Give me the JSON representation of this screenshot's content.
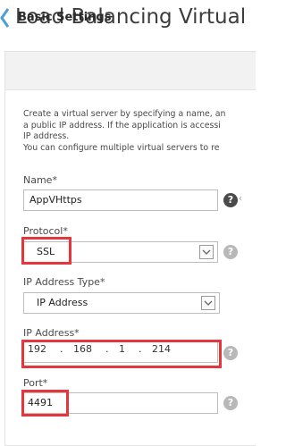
{
  "page": {
    "title": "Load Balancing Virtual"
  },
  "panel": {
    "title": "Basic Settings"
  },
  "description": {
    "lines": [
      "Create a virtual server by specifying a name, an",
      "a public IP address. If the application is accessi",
      "IP address.",
      "You can configure multiple virtual servers to re"
    ]
  },
  "fields": {
    "name": {
      "label": "Name*",
      "value": "AppVHttps"
    },
    "protocol": {
      "label": "Protocol*",
      "value": "SSL"
    },
    "ip_type": {
      "label": "IP Address Type*",
      "value": "IP Address"
    },
    "ip_address": {
      "label": "IP Address*",
      "octets": [
        "192",
        "168",
        "1",
        "214"
      ]
    },
    "port": {
      "label": "Port*",
      "value": "4491"
    }
  },
  "icons": {
    "back": "chevron-left-icon",
    "help": "question-mark-icon",
    "dropdown": "chevron-down-icon"
  },
  "colors": {
    "highlight": "#e4363c",
    "accent": "#4a9fd8",
    "panel_header": "#f2f2f2"
  }
}
